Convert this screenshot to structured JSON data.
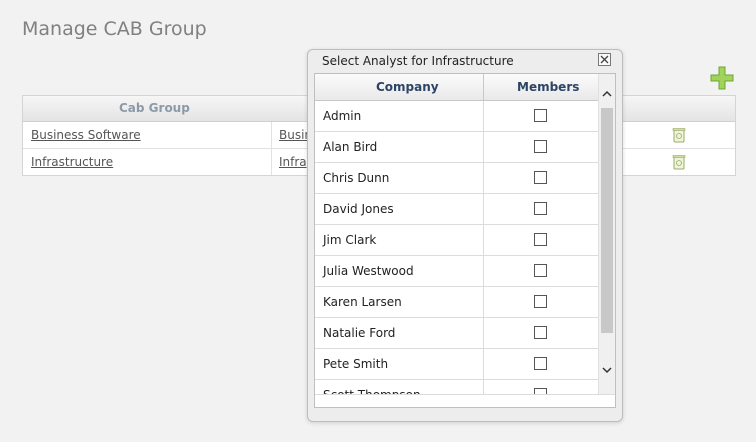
{
  "page": {
    "title": "Manage CAB Group"
  },
  "toolbar": {
    "add_icon": "plus-icon"
  },
  "cab_table": {
    "header": "Cab Group",
    "rows": [
      {
        "name": "Business Software",
        "second": "Busin"
      },
      {
        "name": "Infrastructure",
        "second": "Infra"
      }
    ]
  },
  "dialog": {
    "title": "Select Analyst for Infrastructure",
    "columns": {
      "company": "Company",
      "members": "Members"
    },
    "analysts": [
      "Admin",
      "Alan Bird",
      "Chris Dunn",
      "David Jones",
      "Jim Clark",
      "Julia Westwood",
      "Karen Larsen",
      "Natalie Ford",
      "Pete Smith",
      "Scott Thompson"
    ]
  },
  "colors": {
    "background": "#f2f2f2",
    "header_text": "#2c4566",
    "add_icon": "#8cc63f"
  }
}
